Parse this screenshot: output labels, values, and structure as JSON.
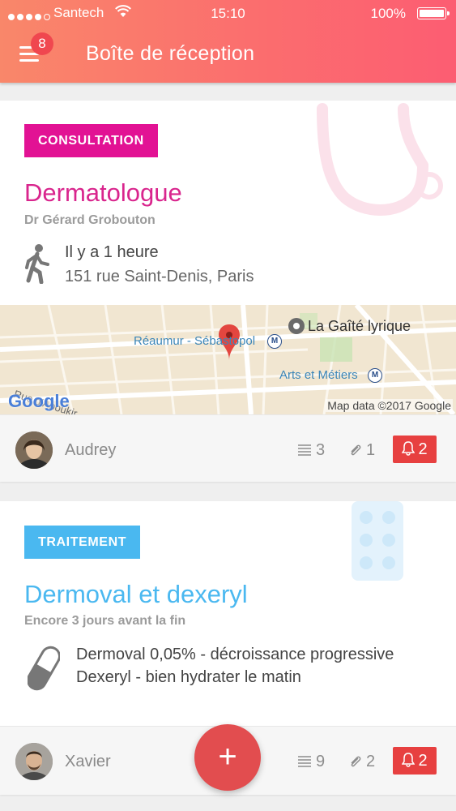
{
  "status_bar": {
    "carrier": "Santech",
    "time": "15:10",
    "battery": "100%"
  },
  "header": {
    "title": "Boîte de réception",
    "menu_badge": "8",
    "gradient": [
      "#f9876a",
      "#fc5d72"
    ]
  },
  "cards": [
    {
      "tag": "CONSULTATION",
      "tag_color": "#e21294",
      "title": "Dermatologue",
      "subtitle": "Dr Gérard Grobouton",
      "icon": "walking-person-icon",
      "time": "Il y a 1 heure",
      "address": "151 rue Saint-Denis, Paris",
      "map": {
        "places": [
          "La Gaîté lyrique",
          "Réaumur - Sébastopol",
          "Arts et Métiers"
        ],
        "street": "Rue d'Aboukir",
        "brand": "Google",
        "attribution": "Map data ©2017 Google"
      },
      "author": "Audrey",
      "notes_count": "3",
      "attachments_count": "1",
      "alerts_count": "2"
    },
    {
      "tag": "TRAITEMENT",
      "tag_color": "#4ab8f0",
      "title": "Dermoval et dexeryl",
      "subtitle": "Encore 3 jours avant la fin",
      "icon": "pill-icon",
      "lines": [
        "Dermoval 0,05% - décroissance progressive",
        "Dexeryl - bien hydrater le matin"
      ],
      "author": "Xavier",
      "notes_count": "9",
      "attachments_count": "2",
      "alerts_count": "2"
    }
  ],
  "fab": {
    "label": "+"
  }
}
